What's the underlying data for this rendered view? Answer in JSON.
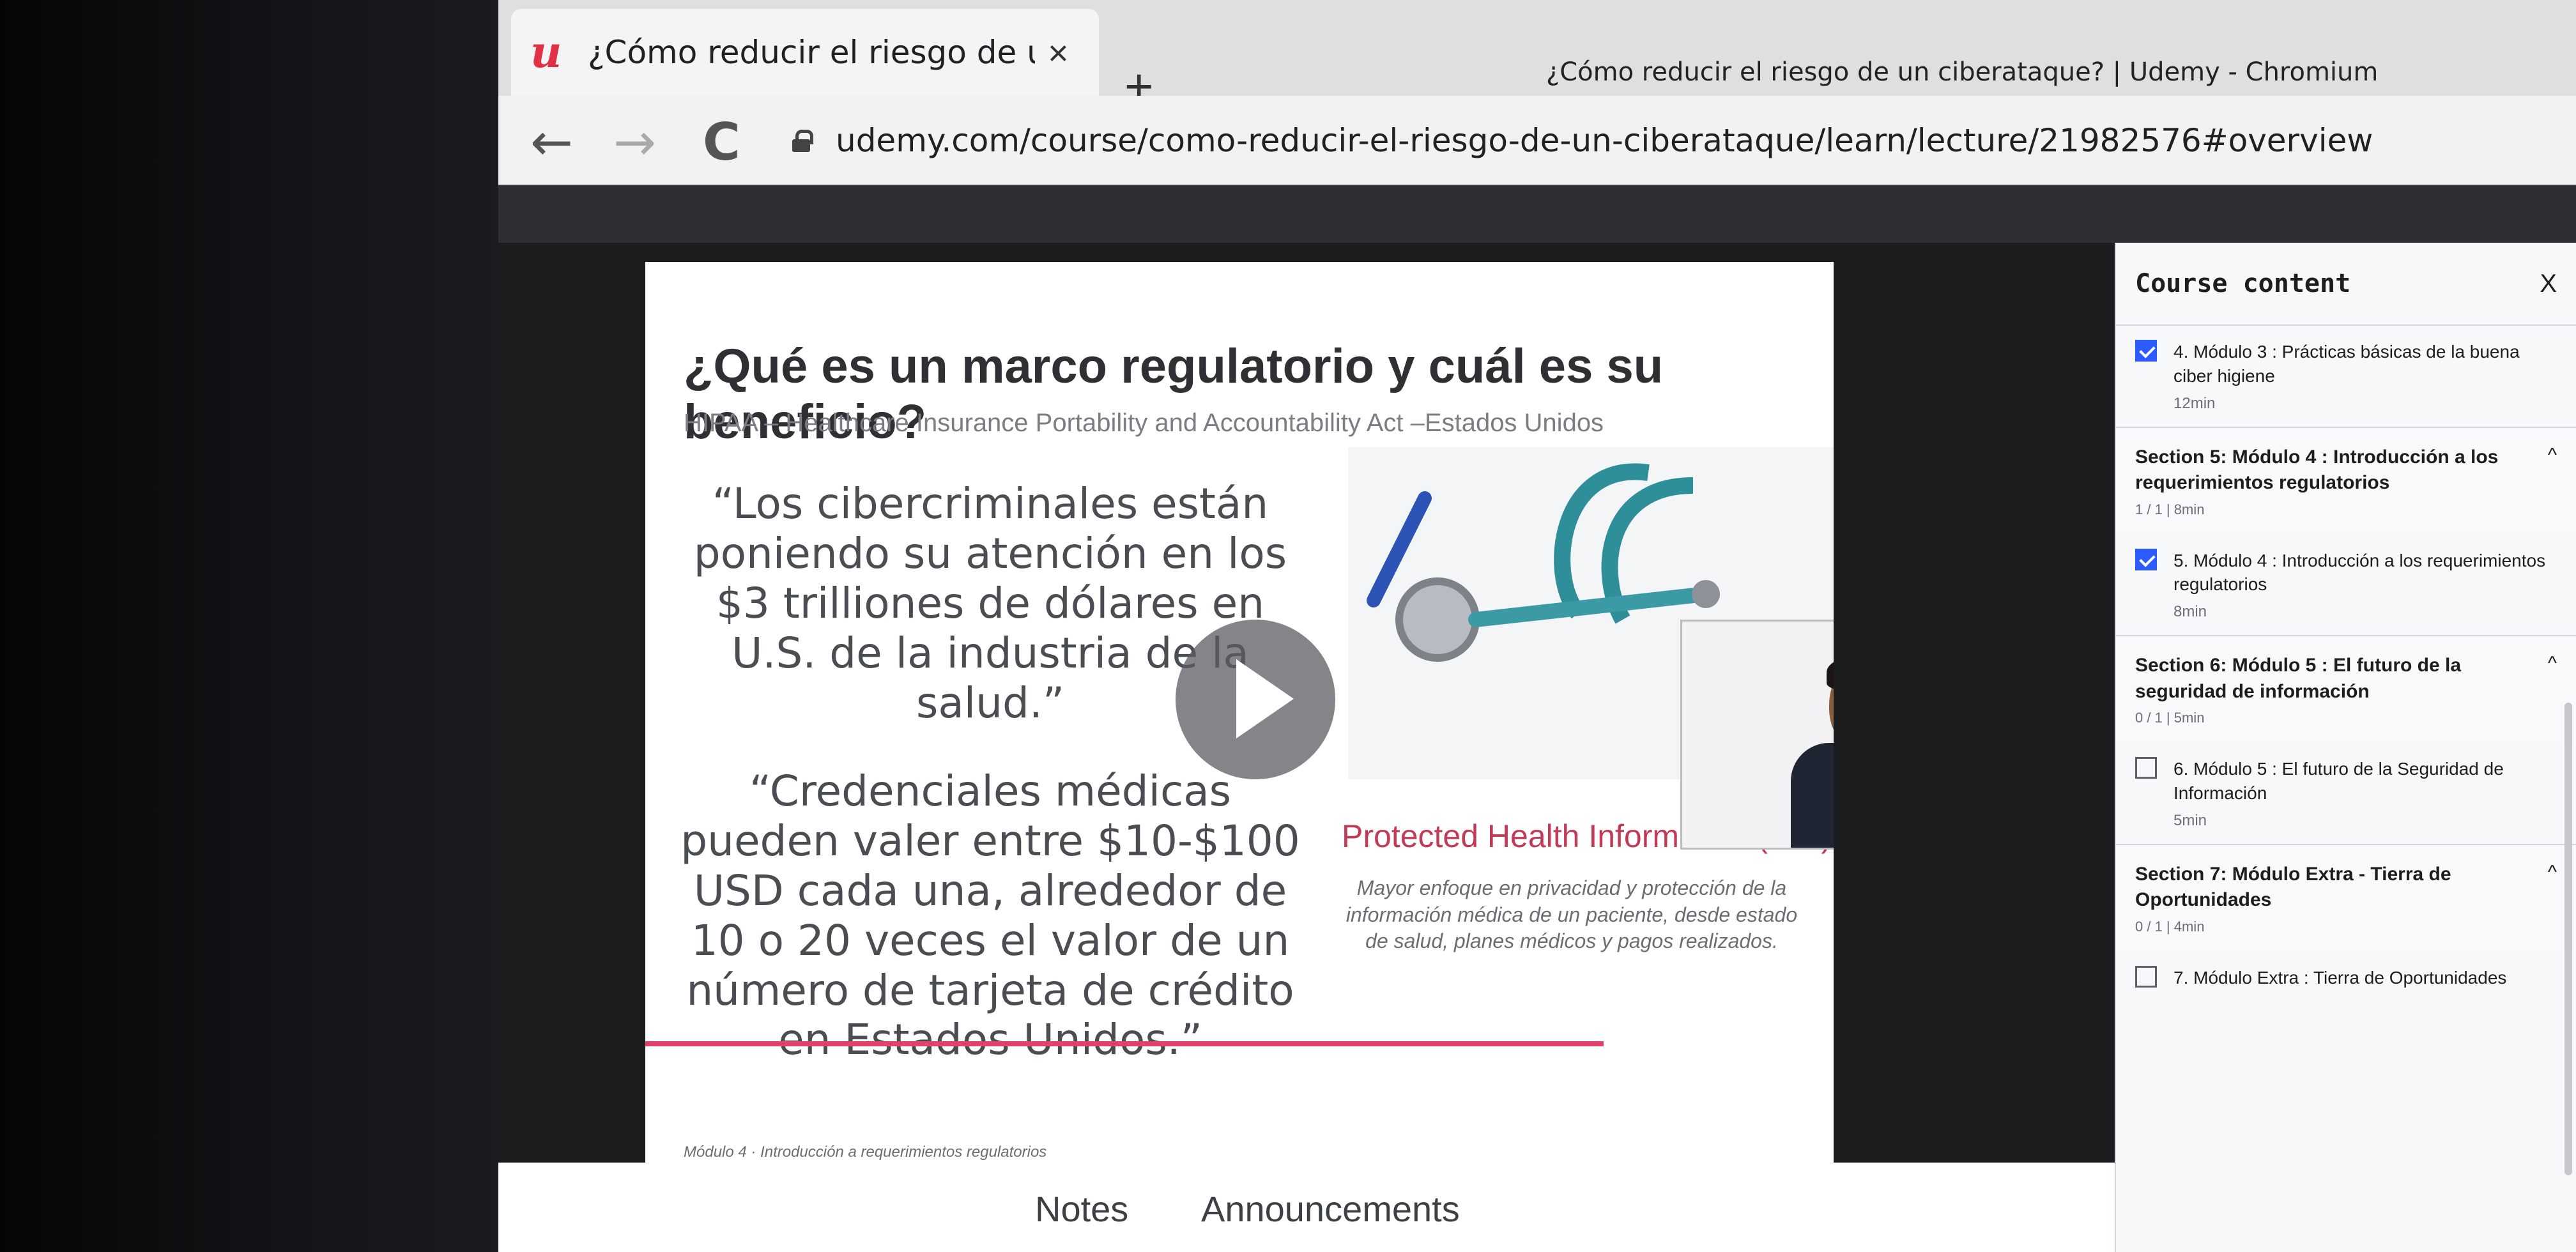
{
  "browser": {
    "tab_title": "¿Cómo reducir el riesgo de un",
    "tab_favicon": "u",
    "window_title": "¿Cómo reducir el riesgo de un ciberataque? | Udemy - Chromium",
    "url": "udemy.com/course/como-reducir-el-riesgo-de-un-ciberataque/learn/lecture/21982576#overview",
    "close_glyph": "×",
    "newtab_glyph": "+",
    "back_glyph": "←",
    "forward_glyph": "→",
    "reload_glyph": "C",
    "actions_glyphs": "☆ ≡ ⋮"
  },
  "slide": {
    "title": "¿Qué es un marco regulatorio y cuál es su beneficio?",
    "subtitle": "HIPAA – Healthcare Insurance Portability and Accountability Act –Estados Unidos",
    "quote1": "“Los cibercriminales están poniendo su atención en los $3 trilliones de dólares en U.S. de la industria de la salud.”",
    "quote2": "“Credenciales médicas pueden valer entre $10-$100 USD cada una, alrededor de 10 o 20 veces el valor de un número de tarjeta de crédito en Estados Unidos.”",
    "phi_title": "Protected Health Information (PHI)",
    "phi_description": "Mayor enfoque en privacidad y protección de la información médica de un paciente, desde estado de salud, planes médicos y pagos realizados.",
    "footer": "Módulo 4 · Introducción a requerimientos regulatorios"
  },
  "page_tabs": [
    "Notes",
    "Announcements"
  ],
  "sidebar": {
    "title": "Course content",
    "close": "X",
    "items": [
      {
        "type": "lecture",
        "checked": true,
        "title": "4. Módulo 3 : Prácticas básicas de la buena ciber higiene",
        "duration": "12min"
      },
      {
        "type": "section",
        "title": "Section 5: Módulo 4 : Introducción a los requerimientos regulatorios",
        "progress": "1 / 1 | 8min",
        "chevron": "^"
      },
      {
        "type": "lecture",
        "checked": true,
        "title": "5. Módulo 4 : Introducción a los requerimientos regulatorios",
        "duration": "8min"
      },
      {
        "type": "section",
        "title": "Section 6: Módulo 5 : El futuro de la seguridad de información",
        "progress": "0 / 1 | 5min",
        "chevron": "^"
      },
      {
        "type": "lecture",
        "checked": false,
        "title": "6. Módulo 5 : El futuro de la Seguridad de Información",
        "duration": "5min"
      },
      {
        "type": "section",
        "title": "Section 7: Módulo Extra - Tierra de Oportunidades",
        "progress": "0 / 1 | 4min",
        "chevron": "^"
      },
      {
        "type": "lecture",
        "checked": false,
        "title": "7. Módulo Extra : Tierra de Oportunidades",
        "duration": ""
      }
    ]
  },
  "colors": {
    "accent": "#e0436a",
    "udemy_brand": "#e03145",
    "checkbox": "#2c5cff"
  }
}
